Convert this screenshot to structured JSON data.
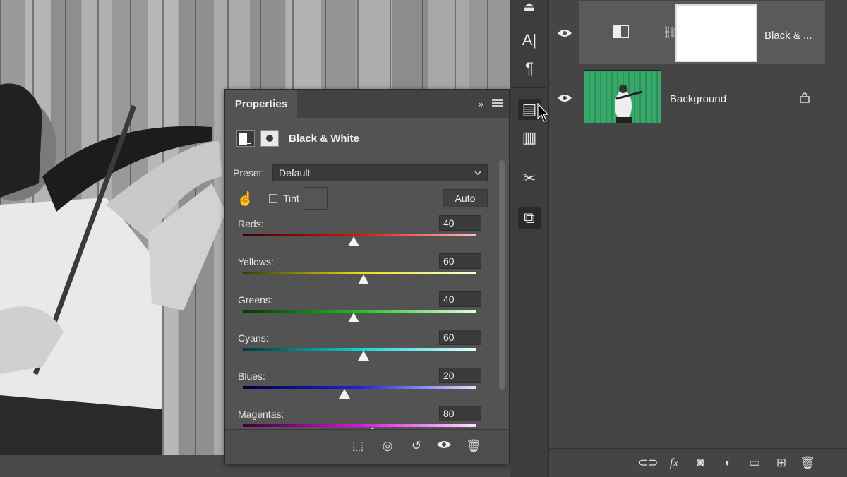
{
  "properties": {
    "tab_label": "Properties",
    "collapse_glyph": "»",
    "adjustment_title": "Black & White",
    "preset_label": "Preset:",
    "preset_value": "Default",
    "tint_label": "Tint",
    "tint_checked": false,
    "auto_label": "Auto",
    "sliders": [
      {
        "label": "Reds:",
        "value": "40",
        "fraction": 0.473
      },
      {
        "label": "Yellows:",
        "value": "60",
        "fraction": 0.518
      },
      {
        "label": "Greens:",
        "value": "40",
        "fraction": 0.473
      },
      {
        "label": "Cyans:",
        "value": "60",
        "fraction": 0.518
      },
      {
        "label": "Blues:",
        "value": "20",
        "fraction": 0.435
      },
      {
        "label": "Magentas:",
        "value": "80",
        "fraction": 0.555
      }
    ],
    "footer_icons": [
      "clip-to-layer-icon",
      "view-previous-icon",
      "reset-icon",
      "visibility-icon",
      "delete-icon"
    ]
  },
  "tools": [
    "stamp-icon",
    "character-icon",
    "paragraph-icon",
    "properties-icon",
    "notes-icon",
    "tool-presets-icon",
    "3d-icon"
  ],
  "layers": [
    {
      "name": "Black & ...",
      "visible": true,
      "selected": true,
      "type": "adjustment"
    },
    {
      "name": "Background",
      "visible": true,
      "selected": false,
      "locked": true,
      "type": "image"
    }
  ],
  "layers_footer_icons": [
    "link-layers-icon",
    "fx-icon",
    "add-mask-icon",
    "new-fill-adjustment-icon",
    "new-group-icon",
    "new-layer-icon",
    "delete-layer-icon"
  ]
}
